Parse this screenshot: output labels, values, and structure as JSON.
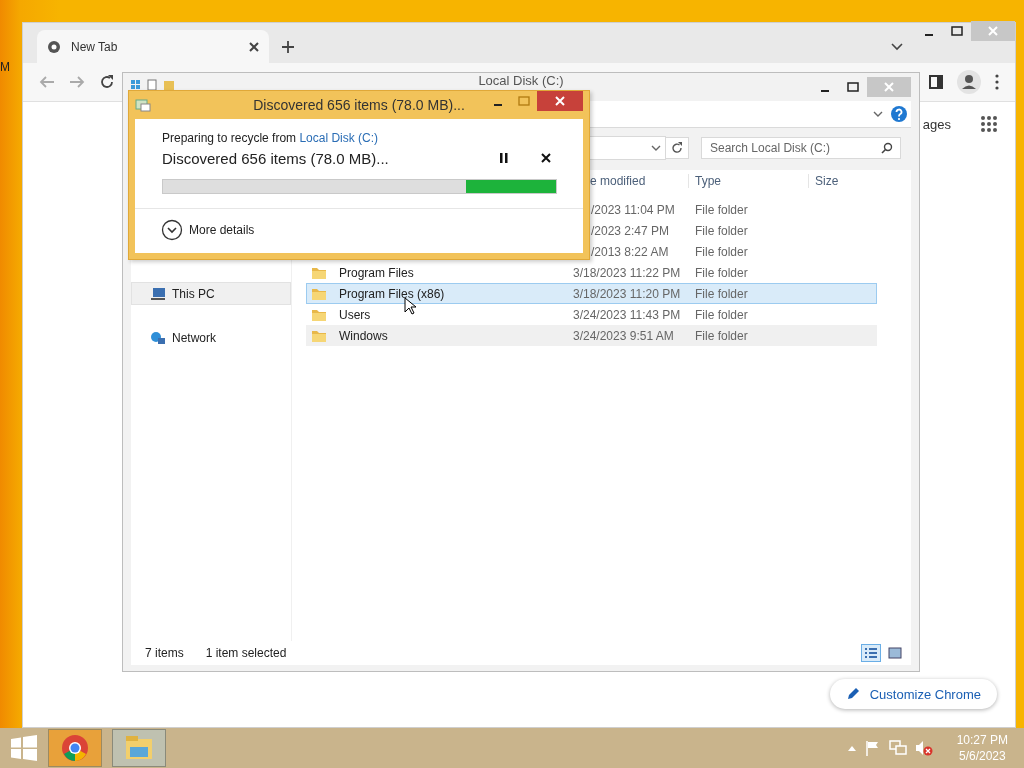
{
  "desktop": {
    "edge_text": "M"
  },
  "chrome": {
    "tabs": [
      {
        "label": "New Tab",
        "selected": true
      }
    ],
    "page_text": "ages",
    "customize_button": "Customize Chrome"
  },
  "explorer": {
    "title": "Local Disk (C:)",
    "search": {
      "placeholder": "Search Local Disk (C:)"
    },
    "columns": [
      {
        "label": "e modified",
        "kind": "covered"
      },
      {
        "label": "Type",
        "kind": "plain"
      },
      {
        "label": "Size",
        "kind": "plain"
      }
    ],
    "nav": [
      {
        "label": "This PC",
        "kind": "pc",
        "selected": true
      },
      {
        "label": "Network",
        "kind": "network",
        "selected": false
      }
    ],
    "rows": [
      {
        "kind": "covered",
        "date": "/2023 11:04 PM",
        "type": "File folder",
        "selected": false,
        "highlighted": false
      },
      {
        "kind": "covered",
        "date": "/2023 2:47 PM",
        "type": "File folder",
        "selected": false,
        "highlighted": false
      },
      {
        "kind": "covered",
        "date": "/2013 8:22 AM",
        "type": "File folder",
        "selected": false,
        "highlighted": false
      },
      {
        "kind": "full",
        "name": "Program Files",
        "date": "3/18/2023 11:22 PM",
        "type": "File folder",
        "selected": false,
        "highlighted": false
      },
      {
        "kind": "full",
        "name": "Program Files (x86)",
        "date": "3/18/2023 11:20 PM",
        "type": "File folder",
        "selected": true,
        "highlighted": false
      },
      {
        "kind": "full",
        "name": "Users",
        "date": "3/24/2023 11:43 PM",
        "type": "File folder",
        "selected": false,
        "highlighted": false
      },
      {
        "kind": "full",
        "name": "Windows",
        "date": "3/24/2023 9:51 AM",
        "type": "File folder",
        "selected": false,
        "highlighted": true
      }
    ],
    "status": {
      "count": "7 items",
      "selection": "1 item selected"
    },
    "views": [
      {
        "kind": "details",
        "selected": true
      },
      {
        "kind": "tiles",
        "selected": false
      }
    ]
  },
  "dialog": {
    "title": "Discovered 656 items (78.0 MB)...",
    "source_prefix": "Preparing to recycle from",
    "source_link": "Local Disk (C:)",
    "status": "Discovered 656 items (78.0 MB)...",
    "progress": {
      "level": 0.23
    },
    "details": "More details"
  },
  "taskbar": {
    "apps": [
      {
        "kind": "chrome",
        "selected": false
      },
      {
        "kind": "explorer",
        "selected": true
      }
    ],
    "clock": {
      "time": "10:27 PM",
      "date": "5/6/2023"
    }
  }
}
